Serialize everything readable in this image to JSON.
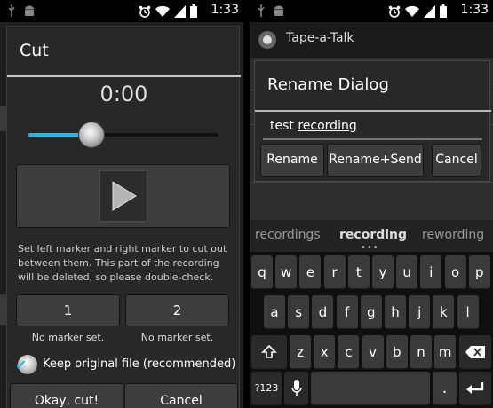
{
  "status_bar": {
    "time": "1:33",
    "icons": [
      "usb-icon",
      "android-icon",
      "alarm-icon",
      "wifi-icon",
      "signal-icon",
      "battery-icon"
    ]
  },
  "cut_dialog": {
    "title": "Cut",
    "time_display": "0:00",
    "slider_level": 0.33,
    "play_button_icon": "play-icon",
    "description": "Set left marker and right marker to cut out between them. This part of the recording will be deleted, so please double-check.",
    "markers": [
      {
        "label": "1",
        "status": "No marker set."
      },
      {
        "label": "2",
        "status": "No marker set."
      }
    ],
    "keep_original": {
      "label": "Keep original file (recommended)",
      "checked": true
    },
    "ok_label": "Okay, cut!",
    "cancel_label": "Cancel"
  },
  "rename_screen": {
    "app_title": "Tape-a-Talk",
    "dialog_title": "Rename Dialog",
    "input_value_prefix": "test ",
    "input_value_word": "recording",
    "buttons": [
      "Rename",
      "Rename+Send",
      "Cancel"
    ],
    "suggestions": [
      "recordings",
      "recording",
      "rewording"
    ],
    "keyboard_rows": [
      [
        "q",
        "w",
        "e",
        "r",
        "t",
        "y",
        "u",
        "i",
        "o",
        "p"
      ],
      [
        "a",
        "s",
        "d",
        "f",
        "g",
        "h",
        "j",
        "k",
        "l"
      ],
      [
        "z",
        "x",
        "c",
        "v",
        "b",
        "n",
        "m"
      ]
    ],
    "key_numbers": "?123",
    "key_period": "."
  },
  "colors": {
    "accent": "#2fb4e0",
    "dialog_bg": "#282828",
    "button_bg": "#3d3d3d"
  }
}
